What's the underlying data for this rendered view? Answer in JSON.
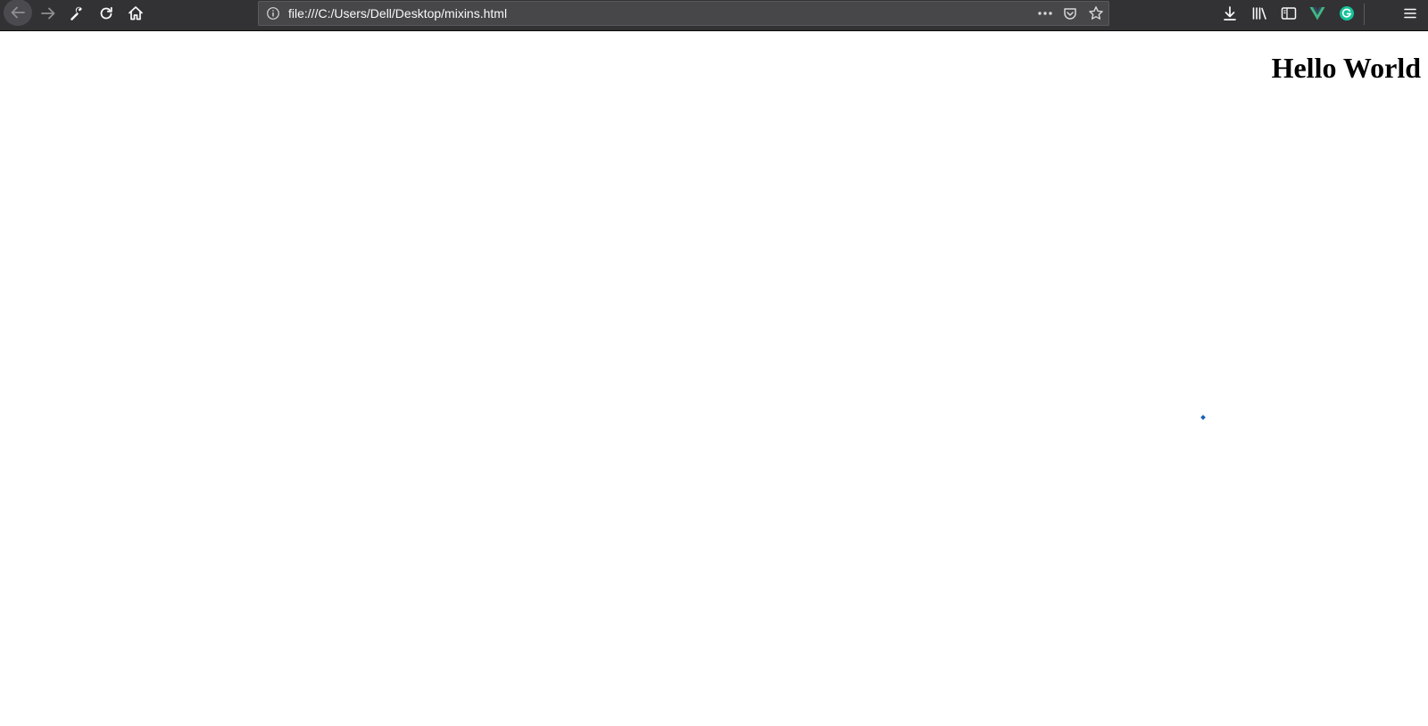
{
  "browser": {
    "url": "file:///C:/Users/Dell/Desktop/mixins.html",
    "nav_icons": [
      "back-arrow-icon",
      "forward-arrow-icon",
      "wrench-icon",
      "reload-icon",
      "home-icon"
    ],
    "url_icons": [
      "info-icon",
      "more-icon",
      "pocket-icon",
      "star-icon"
    ],
    "right_icons": [
      "download-icon",
      "library-icon",
      "sidebar-icon",
      "vue-icon",
      "grammarly-icon",
      "menu-icon"
    ],
    "colors": {
      "toolbar_bg": "#323234",
      "urlbar_bg": "#474749",
      "icon": "#f9f9fa",
      "vue_green": "#41b883",
      "grammarly_green": "#15c39a"
    }
  },
  "page": {
    "heading": "Hello World"
  }
}
